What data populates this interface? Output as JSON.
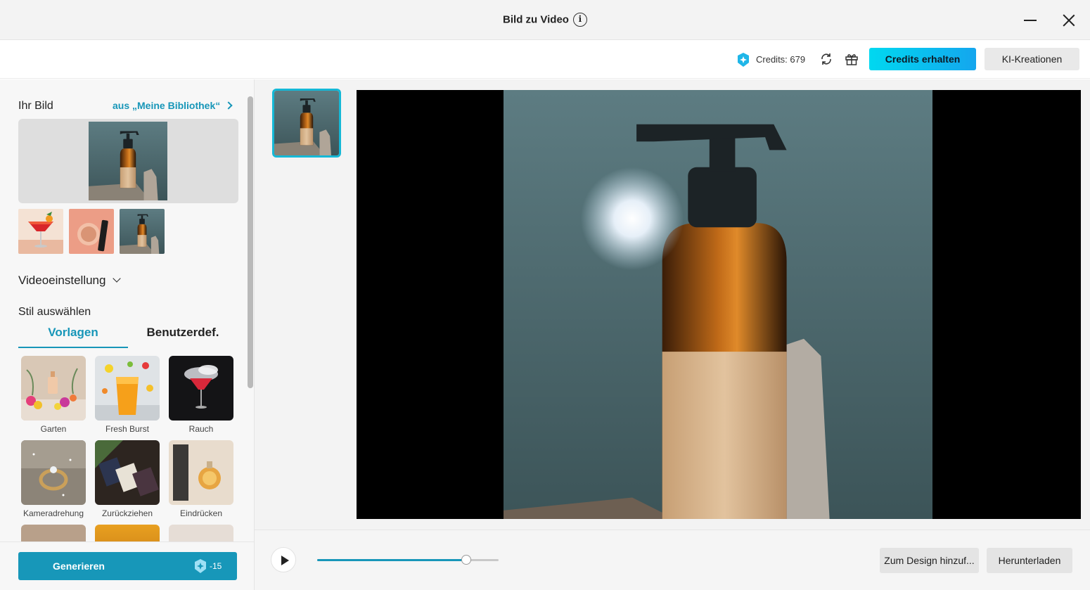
{
  "window": {
    "title": "Bild zu Video",
    "info_icon": "info-icon",
    "minimize_icon": "minimize-icon",
    "close_icon": "close-icon"
  },
  "header": {
    "credits_label": "Credits: 679",
    "credits_icon": "credits-icon",
    "refresh_icon": "refresh-icon",
    "gift_icon": "gift-icon",
    "get_credits_label": "Credits erhalten",
    "ai_creations_label": "KI-Kreationen",
    "accent_gradient": [
      "#00d8f0",
      "#14a6ee"
    ]
  },
  "left": {
    "your_image_label": "Ihr Bild",
    "library_link": "aus „Meine Bibliothek“",
    "recent_images": [
      "cocktail",
      "cosmetics",
      "bottle"
    ],
    "video_setting_label": "Videoeinstellung",
    "style_label": "Stil auswählen",
    "tabs": [
      {
        "label": "Vorlagen",
        "active": true
      },
      {
        "label": "Benutzerdef.",
        "active": false
      }
    ],
    "templates": [
      {
        "label": "Garten"
      },
      {
        "label": "Fresh Burst"
      },
      {
        "label": "Rauch"
      },
      {
        "label": "Kameradrehung"
      },
      {
        "label": "Zurückziehen"
      },
      {
        "label": "Eindrücken"
      }
    ],
    "generate_label": "Generieren",
    "generate_cost": "-15",
    "accent_color": "#1797b9"
  },
  "player": {
    "progress": 0.82,
    "add_to_design_label": "Zum Design hinzuf...",
    "download_label": "Herunterladen"
  }
}
